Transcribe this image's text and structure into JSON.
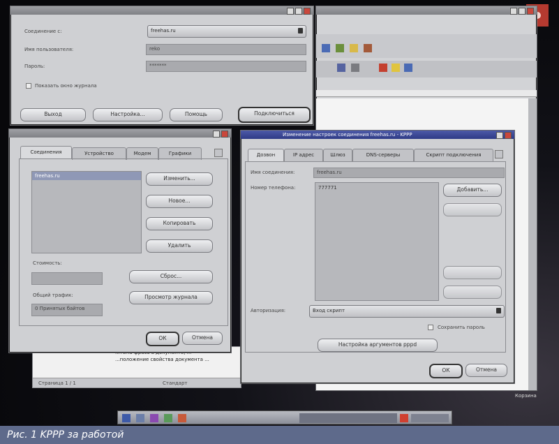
{
  "caption": "Рис. 1 KPPP за работой",
  "main_dialog": {
    "connect_to_label": "Соединение с:",
    "connect_to_value": "freehas.ru",
    "username_label": "Имя пользователя:",
    "username_value": "reko",
    "password_label": "Пароль:",
    "password_value": "*******",
    "show_log_label": "Показать окно журнала",
    "buttons": [
      "Выход",
      "Настройка...",
      "Помощь",
      "Подключиться"
    ]
  },
  "config_dialog": {
    "tabs": [
      "Соединения",
      "Устройство",
      "Модем",
      "Графики"
    ],
    "account_item": "freehas.ru",
    "buttons": [
      "Изменить...",
      "Новое...",
      "Копировать",
      "Удалить"
    ],
    "cost_label": "Стоимость:",
    "reset_button": "Сброс...",
    "traffic_label": "Общий трафик:",
    "traffic_value": "0 Принятых байтов",
    "journal_button": "Просмотр журнала",
    "ok": "ОК",
    "cancel": "Отмена"
  },
  "edit_dialog": {
    "title": "Изменение настроек соединения freehas.ru - KPPP",
    "tabs": [
      "Дозвон",
      "IP адрес",
      "Шлюз",
      "DNS-серверы",
      "Скрипт подключения"
    ],
    "name_label": "Имя соединения:",
    "name_value": "freehas.ru",
    "phone_label": "Номер телефона:",
    "phone_value": "777771",
    "add_button": "Добавить...",
    "auth_label": "Авторизация:",
    "auth_value": "Вход скрипт",
    "save_password": "Сохранить пароль",
    "args_button": "Настройка аргументов pppd",
    "ok": "ОК",
    "cancel": "Отмена"
  },
  "editor_window": {
    "status_left": "Страница 1 / 1",
    "status_mid": "Стандарт",
    "text_line1": "...тема фраза в документе, ...",
    "text_line2": "...положение свойства документа ..."
  },
  "right_label": "Корзина",
  "colors": {
    "caption_bg": "#5e6a8b",
    "active_title": "#2e3a86",
    "window_bg": "#cfd0d3"
  }
}
